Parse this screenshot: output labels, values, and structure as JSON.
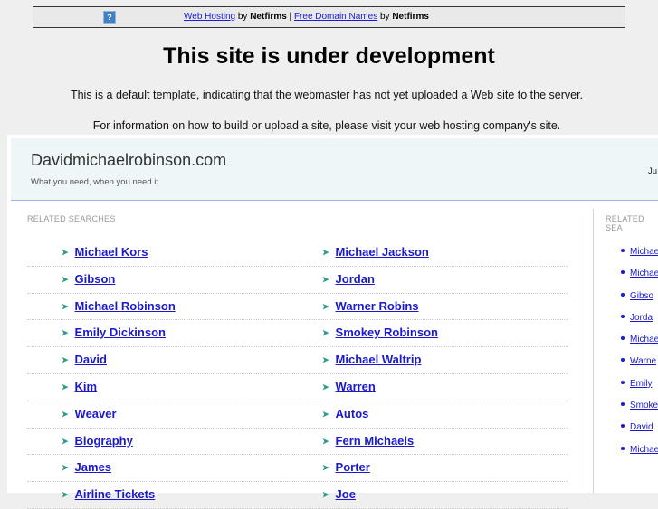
{
  "topbar": {
    "help_icon": "?",
    "link1": "Web Hosting",
    "by1": " by ",
    "brand1": "Netfirms",
    "sep": " | ",
    "link2": "Free Domain Names",
    "by2": " by ",
    "brand2": "Netfirms"
  },
  "heading": "This site is under development",
  "para1": "This is a default template, indicating that the webmaster has not yet uploaded a Web site to the server.",
  "para2": "For information on how to build or upload a site, please visit your web hosting company's site.",
  "site": {
    "name": "Davidmichaelrobinson.com",
    "tagline": "What you need, when you need it",
    "right_text": "Ju"
  },
  "related": {
    "label": "RELATED SEARCHES",
    "rows": [
      [
        "Michael Kors",
        "Michael Jackson"
      ],
      [
        "Gibson",
        "Jordan"
      ],
      [
        "Michael Robinson",
        "Warner Robins"
      ],
      [
        "Emily Dickinson",
        "Smokey Robinson"
      ],
      [
        "David",
        "Michael Waltrip"
      ],
      [
        "Kim",
        "Warren"
      ],
      [
        "Weaver",
        "Autos"
      ],
      [
        "Biography",
        "Fern Michaels"
      ],
      [
        "James",
        "Porter"
      ],
      [
        "Airline Tickets",
        "Joe"
      ]
    ]
  },
  "sidebar": {
    "label": "RELATED SEA",
    "items": [
      "Michae",
      "Michae",
      "Gibso",
      "Jorda",
      "Michae",
      "Warne",
      "Emily",
      "Smoke",
      "David",
      "Michae"
    ]
  }
}
